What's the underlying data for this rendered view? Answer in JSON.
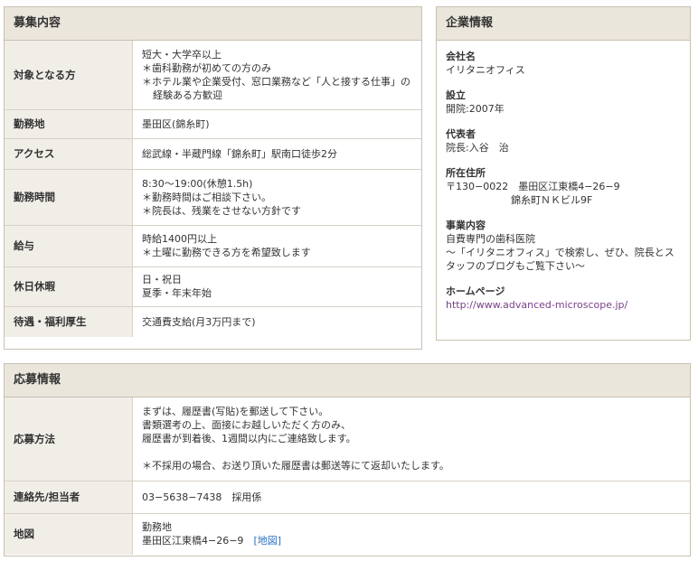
{
  "recruit": {
    "title": "募集内容",
    "rows": [
      {
        "label": "対象となる方",
        "lines": [
          "短大・大学卒以上",
          "＊歯科勤務が初めての方のみ",
          "＊ホテル業や企業受付、窓口業務など「人と接する仕事」の",
          "経験ある方歓迎"
        ]
      },
      {
        "label": "勤務地",
        "lines": [
          "墨田区(錦糸町)"
        ]
      },
      {
        "label": "アクセス",
        "lines": [
          "総武線・半蔵門線「錦糸町」駅南口徒歩2分"
        ]
      },
      {
        "label": "勤務時間",
        "lines": [
          "8:30〜19:00(休憩1.5h)",
          "＊勤務時間はご相談下さい。",
          "＊院長は、残業をさせない方針です"
        ]
      },
      {
        "label": "給与",
        "lines": [
          "時給1400円以上",
          "＊土曜に勤務できる方を希望致します"
        ]
      },
      {
        "label": "休日休暇",
        "lines": [
          "日・祝日",
          "夏季・年末年始"
        ]
      },
      {
        "label": "待遇・福利厚生",
        "lines": [
          "交通費支給(月3万円まで)"
        ]
      }
    ]
  },
  "company": {
    "title": "企業情報",
    "items": [
      {
        "label": "会社名",
        "lines": [
          "イリタニオフィス"
        ]
      },
      {
        "label": "設立",
        "lines": [
          "開院:2007年"
        ]
      },
      {
        "label": "代表者",
        "lines": [
          "院長:入谷　治"
        ]
      },
      {
        "label": "所在住所",
        "lines": [
          "〒130−0022　墨田区江東橋4−26−9",
          "錦糸町ＮＫビル9F"
        ]
      },
      {
        "label": "事業内容",
        "lines": [
          "自費専門の歯科医院",
          "〜「イリタニオフィス」で検索し、ぜひ、院長とス",
          "タッフのブログもご覧下さい〜"
        ]
      },
      {
        "label": "ホームページ",
        "lines": [
          "http://www.advanced-microscope.jp/"
        ]
      }
    ]
  },
  "apply": {
    "title": "応募情報",
    "method_label": "応募方法",
    "method_lines": [
      "まずは、履歴書(写貼)を郵送して下さい。",
      "書類選考の上、面接にお越しいただく方のみ、",
      "履歴書が到着後、1週間以内にご連絡致します。",
      "",
      "＊不採用の場合、お送り頂いた履歴書は郵送等にて返却いたします。"
    ],
    "contact_label": "連絡先/担当者",
    "contact_value": "03−5638−7438　採用係",
    "map_label": "地図",
    "map_line1": "勤務地",
    "map_address": "墨田区江東橋4−26−9",
    "map_link": "[地図]"
  }
}
